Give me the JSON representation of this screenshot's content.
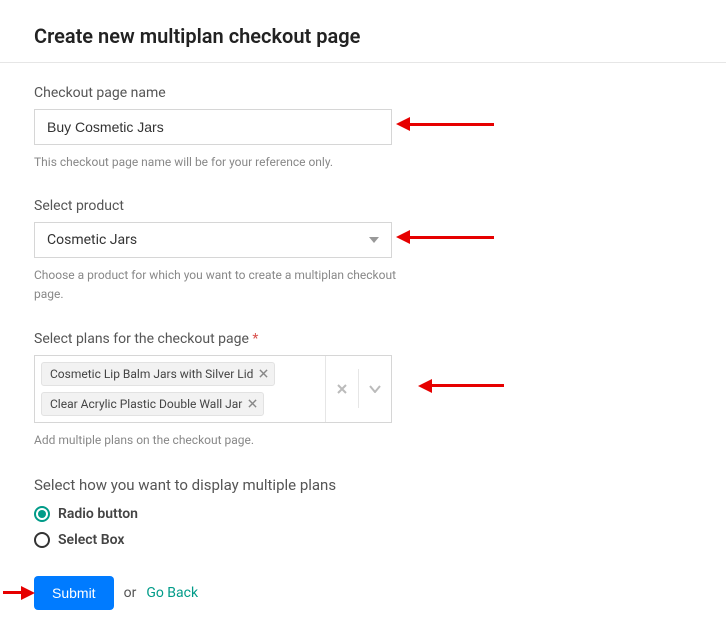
{
  "title": "Create new multiplan checkout page",
  "checkout_name": {
    "label": "Checkout page name",
    "value": "Buy Cosmetic Jars",
    "help": "This checkout page name will be for your reference only."
  },
  "product": {
    "label": "Select product",
    "value": "Cosmetic Jars",
    "help": "Choose a product for which you want to create a multiplan checkout page."
  },
  "plans": {
    "label": "Select plans for the checkout page",
    "required_mark": "*",
    "help": "Add multiple plans on the checkout page.",
    "tags": [
      {
        "label": "Cosmetic Lip Balm Jars with Silver Lid"
      },
      {
        "label": "Clear Acrylic Plastic Double Wall Jar"
      }
    ]
  },
  "display": {
    "title": "Select how you want to display multiple plans",
    "options": [
      {
        "label": "Radio button",
        "selected": true
      },
      {
        "label": "Select Box",
        "selected": false
      }
    ]
  },
  "actions": {
    "submit": "Submit",
    "or": "or",
    "goback": "Go Back"
  }
}
